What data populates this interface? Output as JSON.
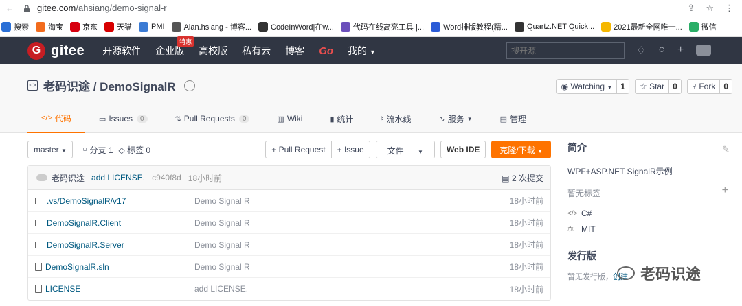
{
  "browser": {
    "url_host": "gitee.com",
    "url_path": "/ahsiang/demo-signal-r"
  },
  "bookmarks": [
    {
      "label": "搜索",
      "color": "#2a6fd6"
    },
    {
      "label": "淘宝",
      "color": "#f26b1d"
    },
    {
      "label": "京东",
      "color": "#d7000f"
    },
    {
      "label": "天猫",
      "color": "#d70000"
    },
    {
      "label": "PMI",
      "color": "#3b7bd4"
    },
    {
      "label": "Alan.hsiang - 博客...",
      "color": "#555555"
    },
    {
      "label": "CodeInWord|在w...",
      "color": "#333333"
    },
    {
      "label": "代码在线高亮工具 |...",
      "color": "#6b4fbb"
    },
    {
      "label": "Word排版教程(精...",
      "color": "#2a5bd7"
    },
    {
      "label": "Quartz.NET Quick...",
      "color": "#333333"
    },
    {
      "label": "2021最新全网唯一...",
      "color": "#f5b700"
    },
    {
      "label": "微信",
      "color": "#2aae67"
    }
  ],
  "nav": {
    "logo": "gitee",
    "items": [
      "开源软件",
      "企业版",
      "高校版",
      "私有云",
      "博客"
    ],
    "special_badge": "特惠",
    "go": "Go",
    "mine": "我的",
    "search_placeholder": "搜开源"
  },
  "project": {
    "title": "老码识途 / DemoSignalR",
    "watching": "Watching",
    "watching_count": "1",
    "star": "Star",
    "star_count": "0",
    "fork": "Fork",
    "fork_count": "0"
  },
  "tabs": [
    {
      "label": "代码",
      "icon": "</>"
    },
    {
      "label": "Issues",
      "count": "0",
      "icon": "▭"
    },
    {
      "label": "Pull Requests",
      "count": "0",
      "icon": "⇅"
    },
    {
      "label": "Wiki",
      "icon": "▥"
    },
    {
      "label": "统计",
      "icon": "▮"
    },
    {
      "label": "流水线",
      "icon": "♮"
    },
    {
      "label": "服务",
      "icon": "∿"
    },
    {
      "label": "管理",
      "icon": "▤"
    }
  ],
  "toolbar": {
    "branch": "master",
    "branches": "分支 1",
    "tags": "标签 0",
    "pull_request": "+ Pull Request",
    "issue": "+ Issue",
    "file": "文件",
    "web_ide": "Web IDE",
    "clone": "克隆/下载"
  },
  "commit": {
    "author": "老码识途",
    "message": "add LICENSE.",
    "hash": "c940f8d",
    "time": "18小时前",
    "count": "2 次提交"
  },
  "files": [
    {
      "name": ".vs/DemoSignalR/v17",
      "type": "folder",
      "msg": "Demo Signal R",
      "time": "18小时前"
    },
    {
      "name": "DemoSignalR.Client",
      "type": "folder",
      "msg": "Demo Signal R",
      "time": "18小时前"
    },
    {
      "name": "DemoSignalR.Server",
      "type": "folder",
      "msg": "Demo Signal R",
      "time": "18小时前"
    },
    {
      "name": "DemoSignalR.sln",
      "type": "file",
      "msg": "Demo Signal R",
      "time": "18小时前"
    },
    {
      "name": "LICENSE",
      "type": "file",
      "msg": "add LICENSE.",
      "time": "18小时前"
    }
  ],
  "sidebar": {
    "intro_title": "简介",
    "description": "WPF+ASP.NET SignalR示例",
    "no_tags": "暂无标签",
    "language": "C#",
    "license": "MIT",
    "release_title": "发行版",
    "release_text": "暂无发行版，",
    "release_link": "创建"
  },
  "watermark": "老码识途",
  "colors": {
    "accent": "#fe7300",
    "nav_bg": "#303643",
    "brand": "#c71d23",
    "link": "#005980"
  }
}
